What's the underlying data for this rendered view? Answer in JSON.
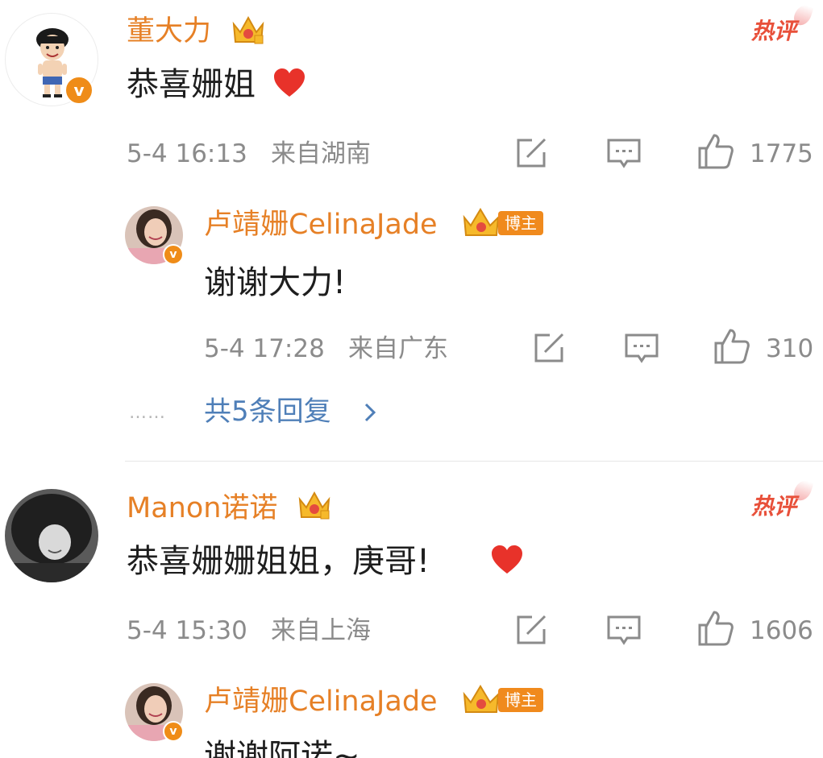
{
  "comments": [
    {
      "author": "董大力",
      "text": "恭喜姗姐",
      "time": "5-4 16:13",
      "location": "来自湖南",
      "likes": "1775",
      "hot_label": "热评",
      "reply": {
        "author": "卢靖姗CelinaJade",
        "badge": "博主",
        "text": "谢谢大力!",
        "time": "5-4 17:28",
        "location": "来自广东",
        "likes": "310"
      },
      "more_replies": "共5条回复",
      "more_dots": "……"
    },
    {
      "author": "Manon诺诺",
      "text": "恭喜姗姗姐姐，庚哥!",
      "time": "5-4 15:30",
      "location": "来自上海",
      "likes": "1606",
      "hot_label": "热评",
      "reply": {
        "author": "卢靖姗CelinaJade",
        "badge": "博主",
        "text": "谢谢阿诺~"
      }
    }
  ],
  "icons": {
    "verified": "v",
    "crown": "crown-icon",
    "repost": "repost-icon",
    "comment": "comment-icon",
    "like": "thumbs-up-icon",
    "chevron": "chevron-right-icon",
    "heart": "heart-icon"
  },
  "colors": {
    "name": "#e68026",
    "hot": "#e8503a",
    "link": "#4f7fb8",
    "meta": "#8b8b8b",
    "text": "#1e1e1e",
    "verified_badge": "#ef8c18",
    "heart": "#e8322a"
  }
}
